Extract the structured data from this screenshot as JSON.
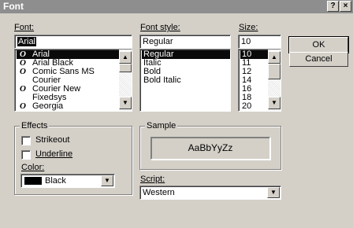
{
  "title_bar": {
    "title": "Font",
    "help_glyph": "?",
    "close_glyph": "×"
  },
  "font": {
    "label": "Font:",
    "value": "Arial",
    "items": [
      {
        "name": "Arial",
        "icon": "O",
        "selected": true
      },
      {
        "name": "Arial Black",
        "icon": "O",
        "selected": false
      },
      {
        "name": "Comic Sans MS",
        "icon": "O",
        "selected": false
      },
      {
        "name": "Courier",
        "icon": "",
        "selected": false
      },
      {
        "name": "Courier New",
        "icon": "O",
        "selected": false
      },
      {
        "name": "Fixedsys",
        "icon": "",
        "selected": false
      },
      {
        "name": "Georgia",
        "icon": "O",
        "selected": false
      }
    ]
  },
  "style": {
    "label": "Font style:",
    "value": "Regular",
    "items": [
      {
        "name": "Regular",
        "selected": true
      },
      {
        "name": "Italic",
        "selected": false
      },
      {
        "name": "Bold",
        "selected": false
      },
      {
        "name": "Bold Italic",
        "selected": false
      }
    ]
  },
  "size": {
    "label": "Size:",
    "value": "10",
    "items": [
      {
        "name": "10",
        "selected": true
      },
      {
        "name": "11",
        "selected": false
      },
      {
        "name": "12",
        "selected": false
      },
      {
        "name": "14",
        "selected": false
      },
      {
        "name": "16",
        "selected": false
      },
      {
        "name": "18",
        "selected": false
      },
      {
        "name": "20",
        "selected": false
      }
    ]
  },
  "buttons": {
    "ok": "OK",
    "cancel": "Cancel"
  },
  "effects": {
    "title": "Effects",
    "strikeout": "Strikeout",
    "underline": "Underline",
    "color_label": "Color:",
    "color_value": "Black",
    "color_swatch": "#000000"
  },
  "sample": {
    "title": "Sample",
    "text": "AaBbYyZz"
  },
  "script": {
    "label": "Script:",
    "value": "Western"
  }
}
